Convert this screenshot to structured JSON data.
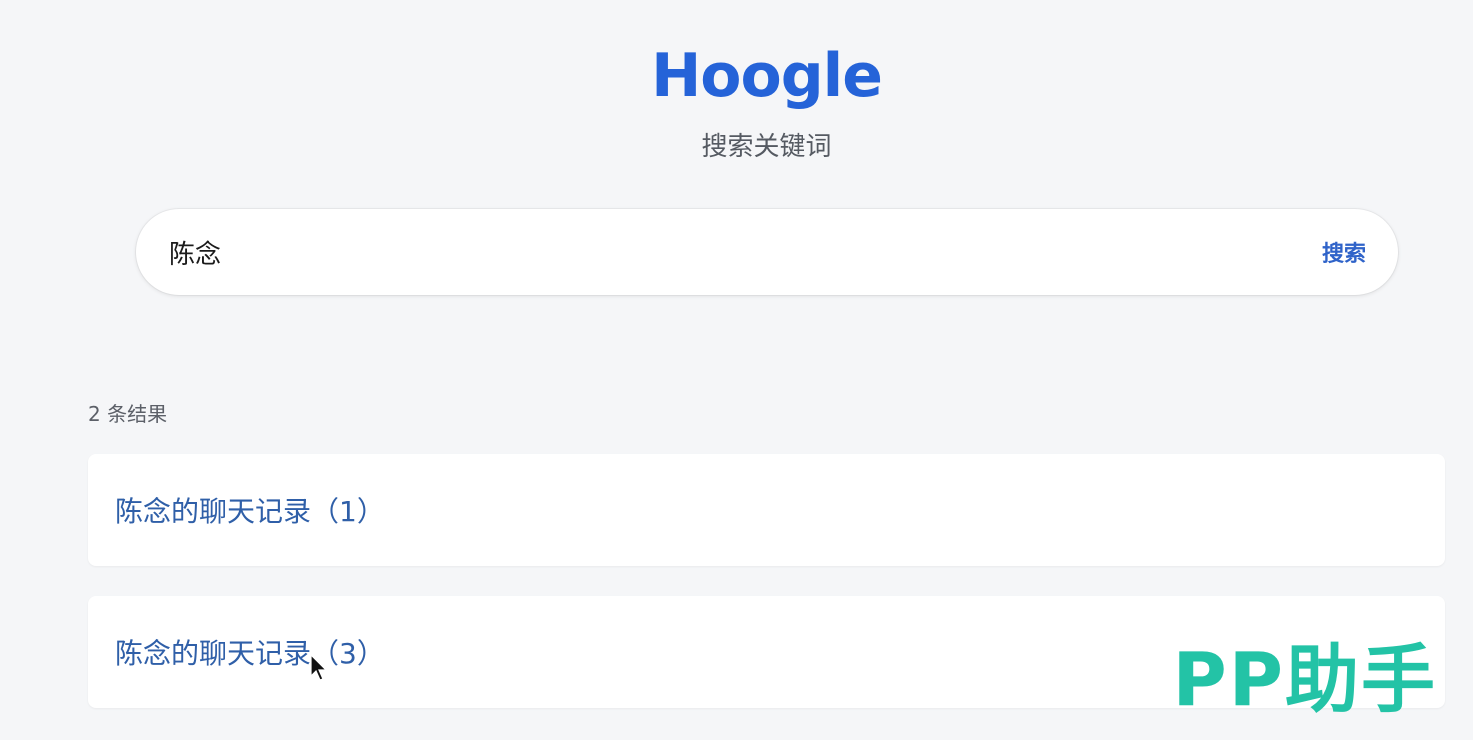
{
  "header": {
    "logo": "Hoogle",
    "subtitle": "搜索关键词"
  },
  "search": {
    "value": "陈念",
    "button_label": "搜索"
  },
  "results": {
    "count_text": "2 条结果",
    "items": [
      {
        "title": "陈念的聊天记录（1）"
      },
      {
        "title": "陈念的聊天记录（3）"
      }
    ]
  },
  "watermark": {
    "text": "PP助手"
  },
  "colors": {
    "brand": "#2563d8",
    "link": "#2f5fa8",
    "background": "#f5f6f8",
    "watermark": "#23c3a6"
  },
  "icons": {
    "cursor": "mouse-pointer-icon"
  }
}
